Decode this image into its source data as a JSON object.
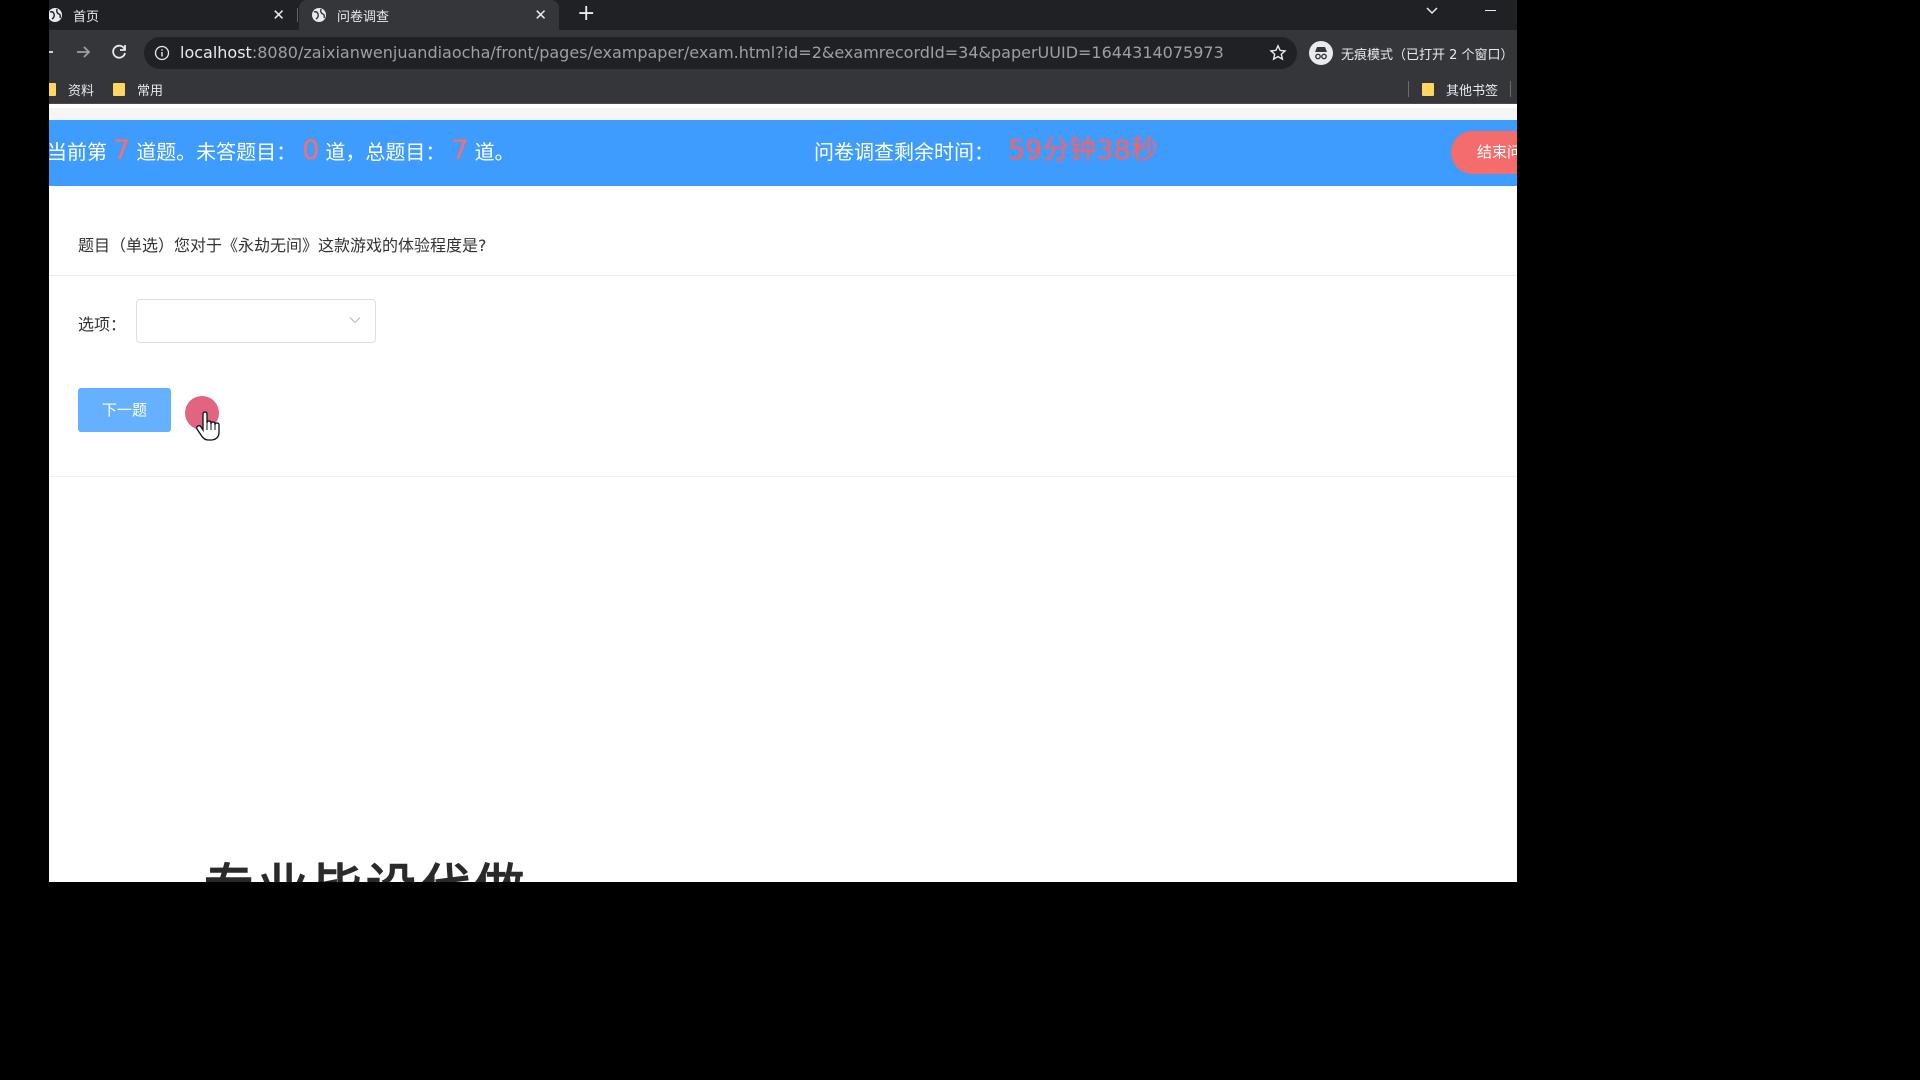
{
  "browser": {
    "tabs": [
      {
        "title": "首页"
      },
      {
        "title": "问卷调查"
      }
    ],
    "url": {
      "host": "localhost",
      "rest": ":8080/zaixianwenjuandiaocha/front/pages/exampaper/exam.html?id=2&examrecordId=34&paperUUID=1644314075973"
    },
    "incognito_label": "无痕模式（已打开 2 个窗口）",
    "bookmarks": [
      {
        "label": "资料"
      },
      {
        "label": "常用"
      },
      {
        "label": "其他书签"
      }
    ]
  },
  "exam_bar": {
    "current_prefix": "当前第",
    "current_num": "7",
    "current_suffix": "道题。未答题目：",
    "unanswered_num": "0",
    "unanswered_suffix": "道，总题目：",
    "total_num": "7",
    "total_suffix": "道。",
    "time_label": "问卷调查剩余时间：",
    "time_value": "59分钟38秒",
    "finish_label": "结束问"
  },
  "question": {
    "text": "题目（单选）您对于《永劫无间》这款游戏的体验程度是?",
    "option_label": "选项：",
    "selected_value": "",
    "next_label": "下一题"
  },
  "overlay_caption": "专业毕设代做",
  "colors": {
    "banner": "#3e9cff",
    "highlight_number": "#ff6b6b",
    "finish_button": "#f56c6c",
    "next_button": "#66b1ff"
  }
}
